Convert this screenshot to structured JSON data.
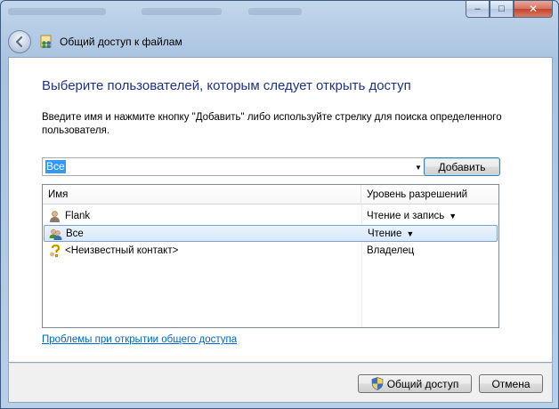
{
  "window": {
    "title": "Общий доступ к файлам",
    "caption_buttons": {
      "minimize": "–",
      "maximize": "□",
      "close": "✕"
    }
  },
  "content": {
    "heading": "Выберите пользователей, которым следует открыть доступ",
    "instructions": "Введите имя и нажмите кнопку \"Добавить\" либо используйте стрелку для поиска определенного пользователя.",
    "combo_value": "Все",
    "add_button": "Добавить",
    "columns": {
      "name": "Имя",
      "permission": "Уровень разрешений"
    },
    "rows": [
      {
        "name": "Flank",
        "permission": "Чтение и запись",
        "has_dropdown": true,
        "icon": "user-icon"
      },
      {
        "name": "Все",
        "permission": "Чтение",
        "has_dropdown": true,
        "icon": "group-icon",
        "selected": true
      },
      {
        "name": "<Неизвестный контакт>",
        "permission": "Владелец",
        "has_dropdown": false,
        "icon": "unknown-contact-icon"
      }
    ],
    "help_link": "Проблемы при открытии общего доступа"
  },
  "footer": {
    "share_button": "Общий доступ",
    "cancel_button": "Отмена"
  },
  "colors": {
    "heading": "#1e3287",
    "link": "#0066cc",
    "selection": "#3399ff"
  }
}
